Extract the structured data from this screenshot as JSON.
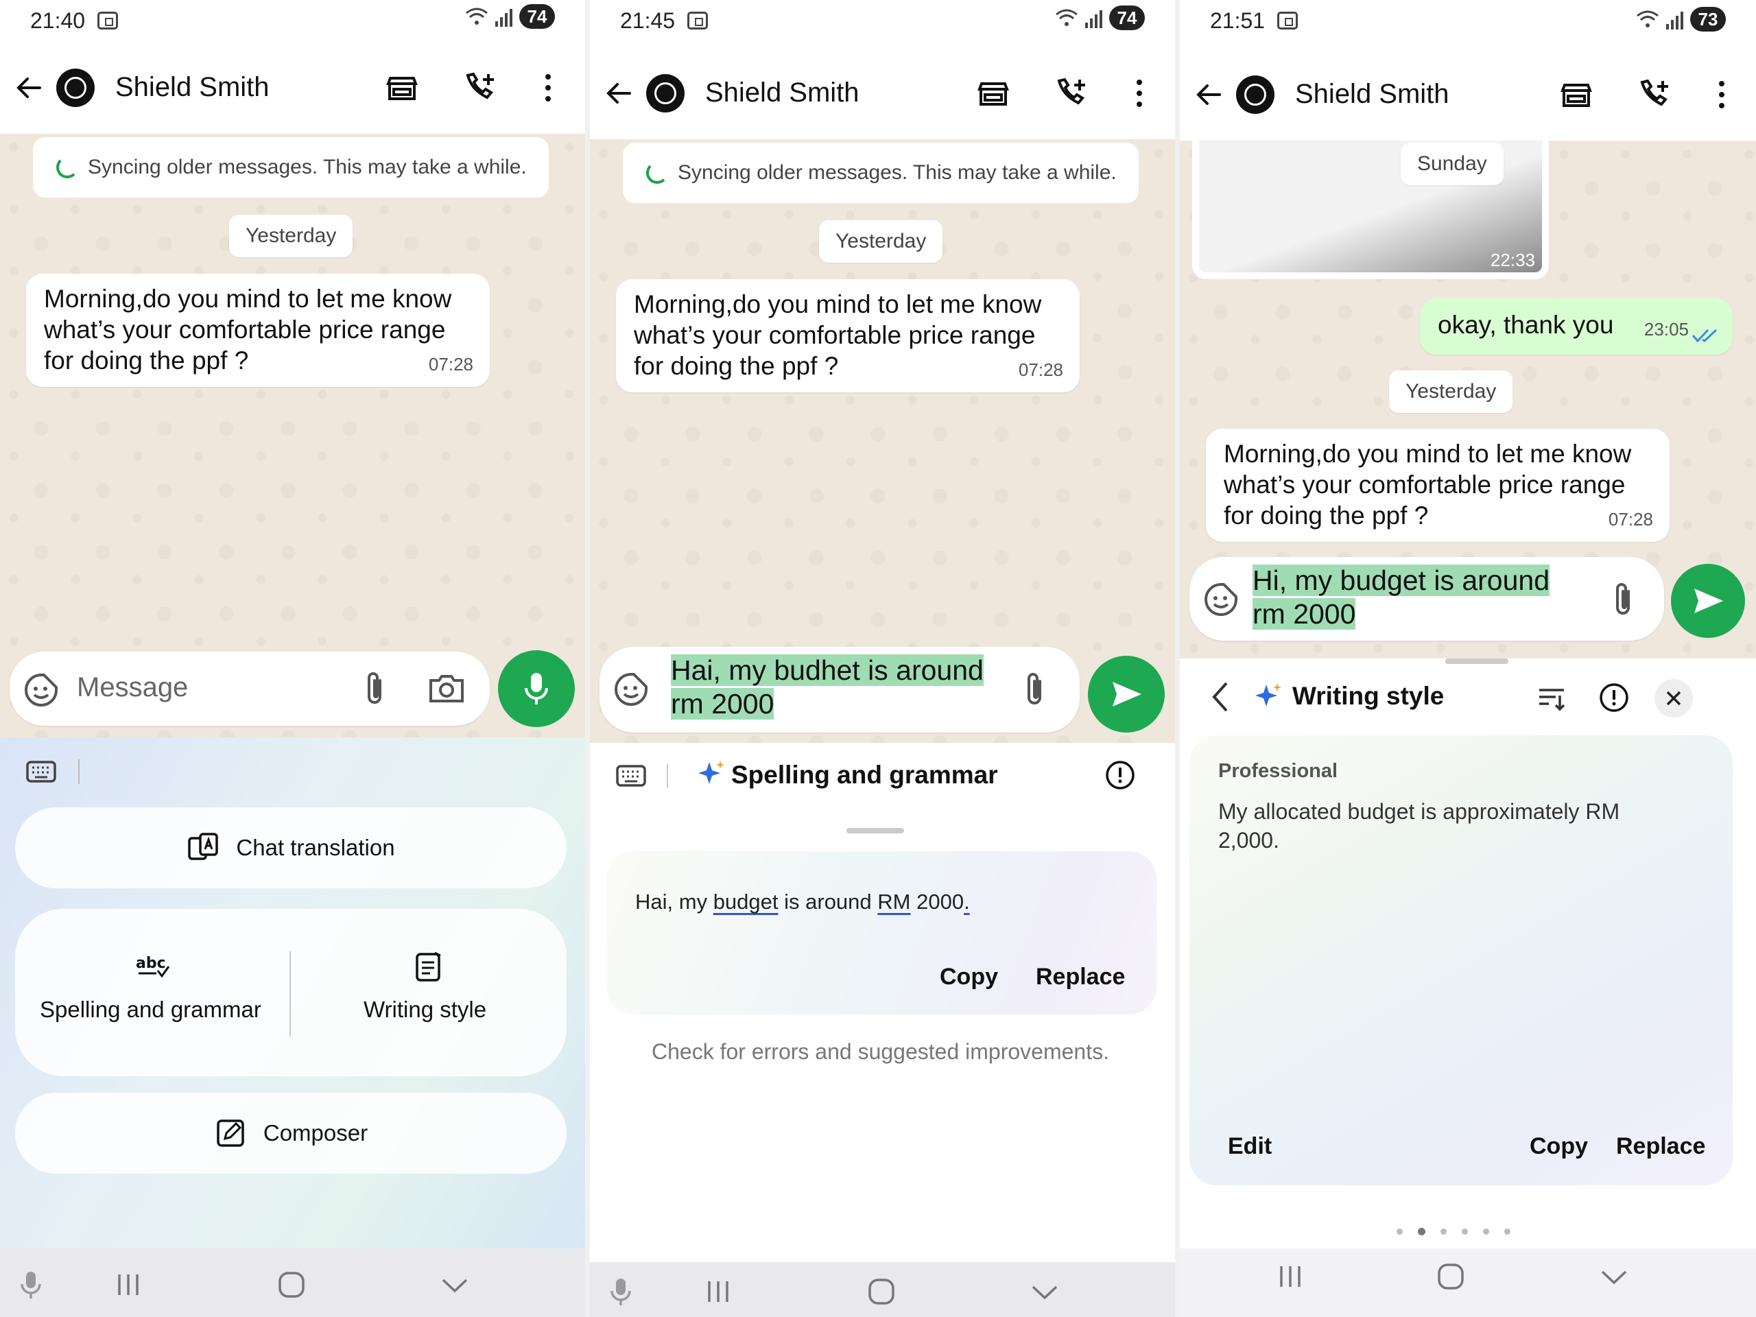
{
  "colors": {
    "accent_green": "#1da851",
    "selection": "#9fdcb3",
    "outgoing_bubble": "#d9fdd3",
    "sparkle": "#2f6be0"
  },
  "contact_name": "Shield Smith",
  "incoming_message": {
    "text_lines": [
      "Morning,do you mind to let me know",
      "what’s your comfortable price range",
      "for doing the ppf ?"
    ],
    "time": "07:28"
  },
  "sync_notice": "Syncing older messages. This may take a while.",
  "day_yesterday": "Yesterday",
  "panels": [
    {
      "time": "21:40",
      "battery": "74",
      "input_placeholder": "Message",
      "tools": {
        "chat_translation": "Chat translation",
        "spelling_grammar": "Spelling and grammar",
        "writing_style": "Writing style",
        "composer": "Composer"
      }
    },
    {
      "time": "21:45",
      "battery": "74",
      "input_lines": [
        "Hai, my budhet is around",
        "rm 2000"
      ],
      "tool_title": "Spelling and grammar",
      "suggestion": {
        "p1": "Hai, my ",
        "w1": "budget",
        "p2": " is around ",
        "w2": "RM",
        "p3": " 2000",
        "w3": "."
      },
      "copy": "Copy",
      "replace": "Replace",
      "hint": "Check for errors and suggested improvements."
    },
    {
      "time": "21:51",
      "battery": "73",
      "day_sunday": "Sunday",
      "image_time": "22:33",
      "outgoing": {
        "text": "okay, thank you",
        "time": "23:05"
      },
      "input_lines": [
        "Hi, my budget is around",
        "rm 2000"
      ],
      "tool_title": "Writing style",
      "style_name": "Professional",
      "style_text_lines": [
        "My allocated budget is approximately RM",
        "2,000."
      ],
      "edit": "Edit",
      "copy": "Copy",
      "replace": "Replace",
      "page_dots": 6,
      "active_dot": 2
    }
  ]
}
